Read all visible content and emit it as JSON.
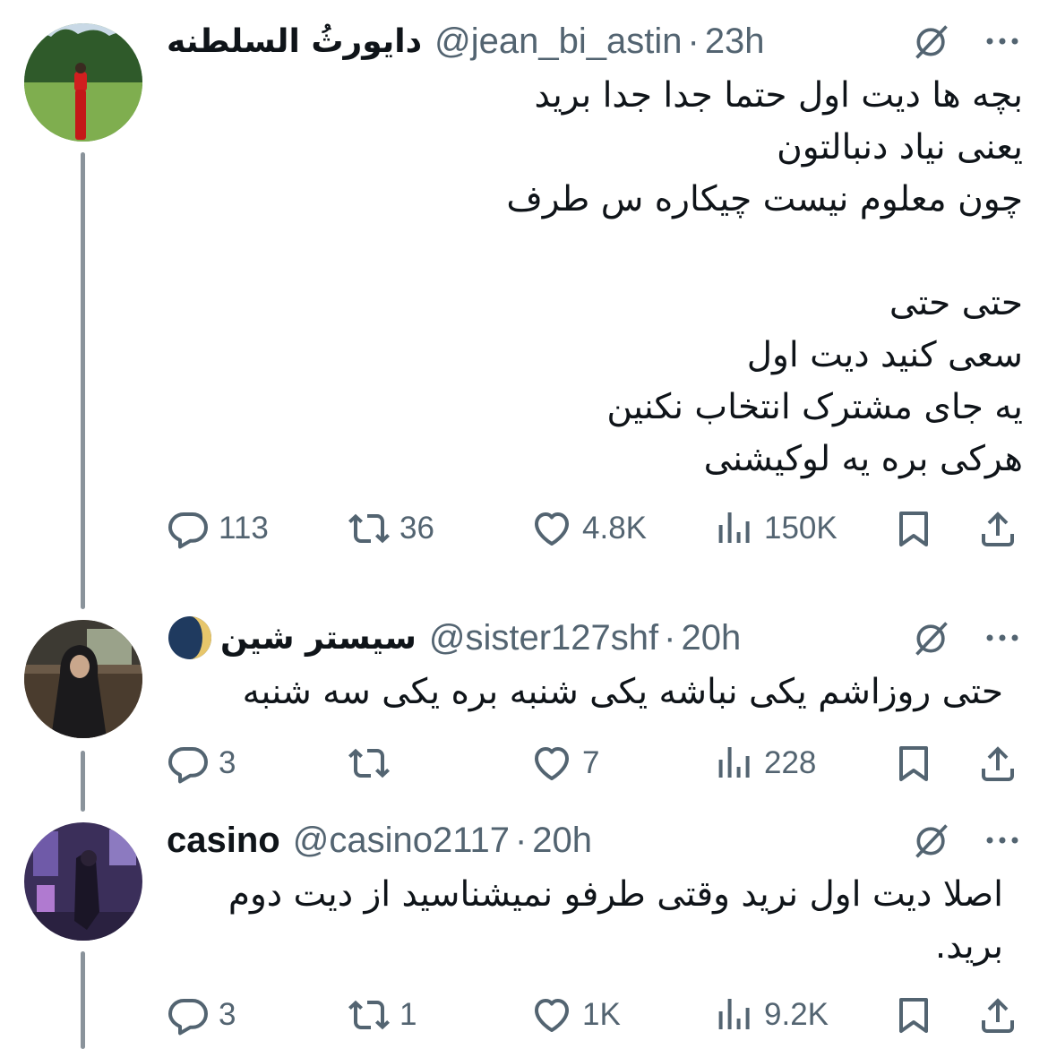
{
  "tweets": [
    {
      "name": "دایورثُ السلطنه",
      "handle": "@jean_bi_astin",
      "time": "23h",
      "lines": [
        "بچه ها دیت اول حتما جدا جدا برید",
        "یعنی نیاد دنبالتون",
        "چون معلوم نیست چیکاره س طرف",
        "",
        "حتی حتی",
        "سعی کنید دیت اول",
        "یه جای مشترک انتخاب نکنین",
        "هرکی بره یه لوکیشنی"
      ],
      "stats": {
        "replies": "113",
        "reposts": "36",
        "likes": "4.8K",
        "views": "150K"
      }
    },
    {
      "name": "سیستر شین",
      "handle": "@sister127shf",
      "time": "20h",
      "lines": [
        "حتی روزاشم یکی نباشه یکی شنبه بره یکی سه شنبه"
      ],
      "stats": {
        "replies": "3",
        "reposts": "",
        "likes": "7",
        "views": "228"
      }
    },
    {
      "name": "casino",
      "handle": "@casino2117",
      "time": "20h",
      "lines": [
        "اصلا دیت اول نرید وقتی طرفو نمیشناسید از دیت دوم",
        "برید."
      ],
      "stats": {
        "replies": "3",
        "reposts": "1",
        "likes": "1K",
        "views": "9.2K"
      }
    }
  ],
  "separator": "·",
  "icons": {
    "reply": "reply-icon",
    "repost": "repost-icon",
    "like": "heart-icon",
    "views": "views-icon",
    "bookmark": "bookmark-icon",
    "share": "share-icon",
    "grok": "grok-icon",
    "more": "more-icon",
    "badge": "moon-badge-icon"
  },
  "colors": {
    "text": "#0f1419",
    "secondary": "#536471",
    "thread": "#8a939b"
  }
}
